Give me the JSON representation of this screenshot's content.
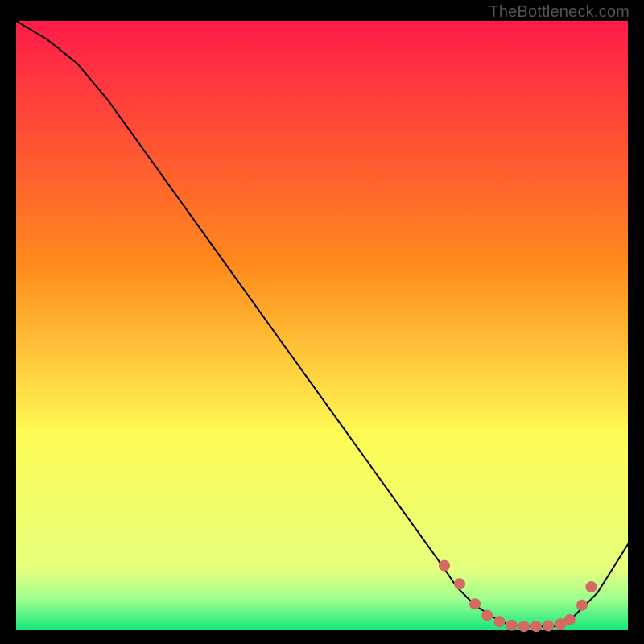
{
  "watermark": "TheBottleneck.com",
  "colors": {
    "frame": "#000000",
    "curve": "#000000",
    "marker": "#d36b63",
    "green": "#17e87a",
    "yellow": "#fffb55",
    "red_top": "#ff1b4a",
    "red_bottom": "#ff8a1c"
  },
  "chart_data": {
    "type": "line",
    "title": "",
    "xlabel": "",
    "ylabel": "",
    "xlim": [
      0,
      100
    ],
    "ylim": [
      0,
      100
    ],
    "x": [
      0,
      5,
      10,
      15,
      20,
      25,
      30,
      35,
      40,
      45,
      50,
      55,
      60,
      65,
      70,
      72,
      75,
      78,
      80,
      83,
      85,
      88,
      90,
      92,
      95,
      100
    ],
    "values": [
      100,
      97,
      93,
      87,
      80,
      73,
      66,
      59,
      52,
      45,
      38,
      31,
      24,
      17,
      10,
      7,
      4,
      2,
      1,
      0.5,
      0.5,
      0.5,
      1,
      3,
      6,
      14
    ],
    "series": [
      {
        "name": "bottleneck-curve",
        "x": [
          0,
          5,
          10,
          15,
          20,
          25,
          30,
          35,
          40,
          45,
          50,
          55,
          60,
          65,
          70,
          72,
          75,
          78,
          80,
          83,
          85,
          88,
          90,
          92,
          95,
          100
        ],
        "y": [
          100,
          97,
          93,
          87,
          80,
          73,
          66,
          59,
          52,
          45,
          38,
          31,
          24,
          17,
          10,
          7,
          4,
          2,
          1,
          0.5,
          0.5,
          0.5,
          1,
          3,
          6,
          14
        ]
      }
    ],
    "markers": {
      "name": "optimal-region-points",
      "x": [
        70,
        72.5,
        75,
        77,
        79,
        81,
        83,
        85,
        87,
        89,
        90.5,
        92.5,
        94
      ],
      "y": [
        10.5,
        7.5,
        4.2,
        2.3,
        1.3,
        0.7,
        0.5,
        0.5,
        0.6,
        0.9,
        1.6,
        4.0,
        7.0
      ]
    },
    "background_gradient": {
      "direction": "vertical",
      "stops": [
        {
          "pos": 0.0,
          "color": "#ff1b4a"
        },
        {
          "pos": 0.4,
          "color": "#ff8a1c"
        },
        {
          "pos": 0.68,
          "color": "#fffb55"
        },
        {
          "pos": 0.9,
          "color": "#e7ff7d"
        },
        {
          "pos": 0.95,
          "color": "#9fff8f"
        },
        {
          "pos": 1.0,
          "color": "#17e87a"
        }
      ]
    }
  }
}
